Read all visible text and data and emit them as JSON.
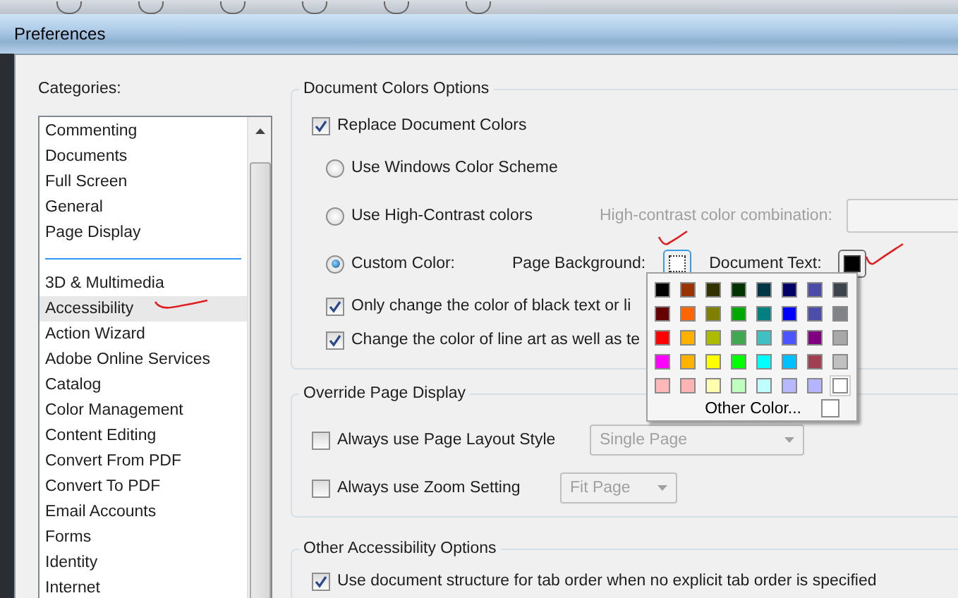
{
  "window": {
    "title": "Preferences"
  },
  "categories": {
    "label": "Categories:",
    "groups": [
      {
        "items": [
          {
            "label": "Commenting",
            "selected": false
          },
          {
            "label": "Documents",
            "selected": false
          },
          {
            "label": "Full Screen",
            "selected": false
          },
          {
            "label": "General",
            "selected": false
          },
          {
            "label": "Page Display",
            "selected": false
          }
        ]
      },
      {
        "items": [
          {
            "label": "3D & Multimedia",
            "selected": false
          },
          {
            "label": "Accessibility",
            "selected": true
          },
          {
            "label": "Action Wizard",
            "selected": false
          },
          {
            "label": "Adobe Online Services",
            "selected": false
          },
          {
            "label": "Catalog",
            "selected": false
          },
          {
            "label": "Color Management",
            "selected": false
          },
          {
            "label": "Content Editing",
            "selected": false
          },
          {
            "label": "Convert From PDF",
            "selected": false
          },
          {
            "label": "Convert To PDF",
            "selected": false
          },
          {
            "label": "Email Accounts",
            "selected": false
          },
          {
            "label": "Forms",
            "selected": false
          },
          {
            "label": "Identity",
            "selected": false
          },
          {
            "label": "Internet",
            "selected": false
          }
        ]
      }
    ]
  },
  "document_colors": {
    "legend": "Document Colors Options",
    "replace": {
      "label": "Replace Document Colors",
      "checked": true
    },
    "options": [
      {
        "label": "Use Windows Color Scheme",
        "selected": false
      },
      {
        "label": "Use High-Contrast colors",
        "selected": false,
        "combo_label": "High-contrast color combination:"
      },
      {
        "label": "Custom Color:",
        "selected": true
      }
    ],
    "page_background": {
      "label": "Page Background:",
      "color": "#ffffff"
    },
    "document_text": {
      "label": "Document Text:",
      "color": "#000000"
    },
    "checks": [
      {
        "label": "Only change the color of black text or li",
        "checked": true
      },
      {
        "label": "Change the color of line art as well as te",
        "checked": true
      }
    ],
    "palette": {
      "rows": [
        [
          {
            "color": "#000000",
            "selected": false
          },
          {
            "color": "#993300",
            "selected": false
          },
          {
            "color": "#333300",
            "selected": false
          },
          {
            "color": "#003300",
            "selected": false
          },
          {
            "color": "#003645",
            "selected": false
          },
          {
            "color": "#000066",
            "selected": false
          },
          {
            "color": "#4b4ba8",
            "selected": false
          },
          {
            "color": "#3c434a",
            "selected": false
          }
        ],
        [
          {
            "color": "#660000",
            "selected": false
          },
          {
            "color": "#ff6600",
            "selected": false
          },
          {
            "color": "#808000",
            "selected": false
          },
          {
            "color": "#00a800",
            "selected": false
          },
          {
            "color": "#008080",
            "selected": false
          },
          {
            "color": "#0000ff",
            "selected": false
          },
          {
            "color": "#4d4daa",
            "selected": false
          },
          {
            "color": "#808488",
            "selected": false
          }
        ],
        [
          {
            "color": "#ff0000",
            "selected": false
          },
          {
            "color": "#ffb000",
            "selected": false
          },
          {
            "color": "#aabb00",
            "selected": false
          },
          {
            "color": "#40a850",
            "selected": false
          },
          {
            "color": "#40c0c0",
            "selected": false
          },
          {
            "color": "#4a55ff",
            "selected": false
          },
          {
            "color": "#800080",
            "selected": false
          },
          {
            "color": "#a8a8a8",
            "selected": false
          }
        ],
        [
          {
            "color": "#ff00ff",
            "selected": false
          },
          {
            "color": "#ffb200",
            "selected": false
          },
          {
            "color": "#ffff00",
            "selected": false
          },
          {
            "color": "#00ff00",
            "selected": false
          },
          {
            "color": "#00ffff",
            "selected": false
          },
          {
            "color": "#00bfff",
            "selected": false
          },
          {
            "color": "#a04050",
            "selected": false
          },
          {
            "color": "#c0c0c0",
            "selected": false
          }
        ],
        [
          {
            "color": "#ffb8b8",
            "selected": false
          },
          {
            "color": "#ffb4b4",
            "selected": false
          },
          {
            "color": "#ffffb0",
            "selected": false
          },
          {
            "color": "#c0ffc0",
            "selected": false
          },
          {
            "color": "#c0ffff",
            "selected": false
          },
          {
            "color": "#b8b8ff",
            "selected": false
          },
          {
            "color": "#b4b4ff",
            "selected": false
          },
          {
            "color": "#ffffff",
            "selected": true
          }
        ]
      ],
      "other_label": "Other Color..."
    }
  },
  "override": {
    "legend": "Override Page Display",
    "rows": [
      {
        "label": "Always use Page Layout Style",
        "checked": false,
        "dropdown": {
          "value": "Single Page",
          "disabled": true
        }
      },
      {
        "label": "Always use Zoom Setting",
        "checked": false,
        "dropdown": {
          "value": "Fit Page",
          "disabled": true
        }
      }
    ]
  },
  "other_options": {
    "legend": "Other Accessibility Options",
    "rows": [
      {
        "label": "Use document structure for tab order when no explicit tab order is specified",
        "checked": true
      }
    ]
  }
}
